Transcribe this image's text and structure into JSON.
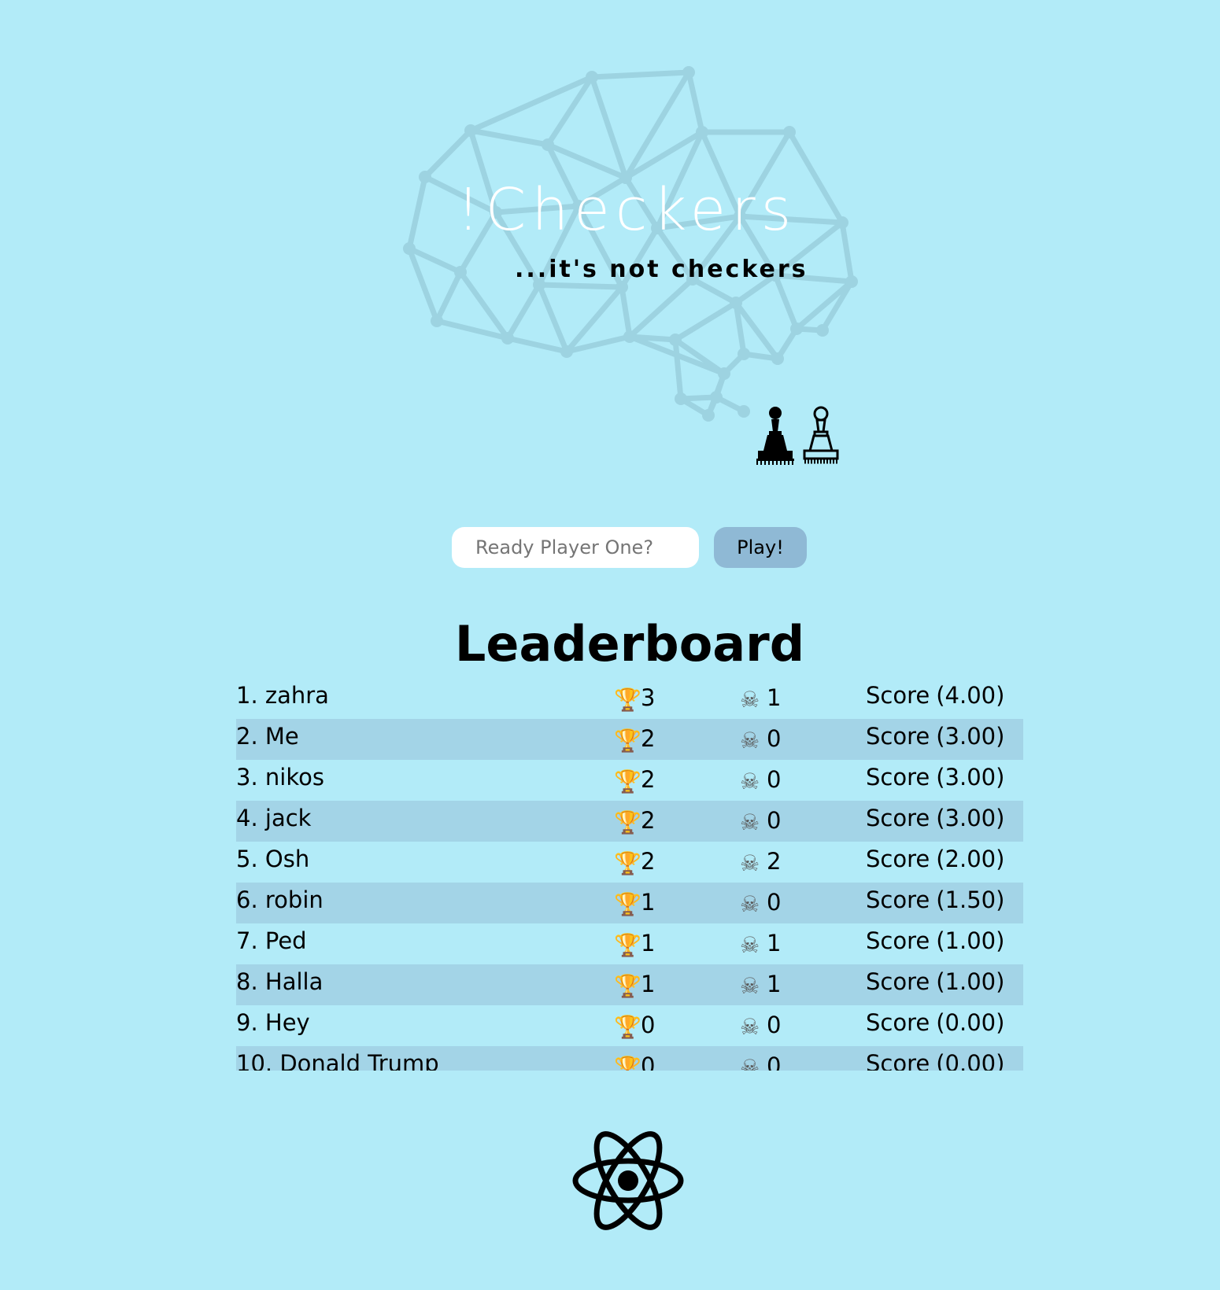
{
  "app": {
    "title": "!Checkers",
    "subtitle": "...it's not checkers"
  },
  "colors": {
    "background": "#b2ebf8",
    "row_alt": "#a3d4e7",
    "play_button": "#8fb9d5",
    "brain": "#9dd3e1"
  },
  "icons": {
    "logo": "brain-network-icon",
    "pieces": [
      "black-pawn-icon",
      "white-pawn-icon"
    ],
    "wins": "trophy-icon",
    "losses": "skull-crossbones-icon",
    "footer": "react-atom-icon"
  },
  "player_form": {
    "input_placeholder": "Ready Player One?",
    "input_value": "",
    "play_label": "Play!"
  },
  "leaderboard": {
    "title": "Leaderboard",
    "score_label": "Score",
    "rows": [
      {
        "rank_name": "1. zahra",
        "wins": "3",
        "losses": "1",
        "score": "(4.00)"
      },
      {
        "rank_name": "2. Me",
        "wins": "2",
        "losses": "0",
        "score": "(3.00)"
      },
      {
        "rank_name": "3. nikos",
        "wins": "2",
        "losses": "0",
        "score": "(3.00)"
      },
      {
        "rank_name": "4. jack",
        "wins": "2",
        "losses": "0",
        "score": "(3.00)"
      },
      {
        "rank_name": "5. Osh",
        "wins": "2",
        "losses": "2",
        "score": "(2.00)"
      },
      {
        "rank_name": "6. robin",
        "wins": "1",
        "losses": "0",
        "score": "(1.50)"
      },
      {
        "rank_name": "7. Ped",
        "wins": "1",
        "losses": "1",
        "score": "(1.00)"
      },
      {
        "rank_name": "8. Halla",
        "wins": "1",
        "losses": "1",
        "score": "(1.00)"
      },
      {
        "rank_name": "9. Hey",
        "wins": "0",
        "losses": "0",
        "score": "(0.00)"
      },
      {
        "rank_name": "10. Donald Trump",
        "wins": "0",
        "losses": "0",
        "score": "(0.00)"
      }
    ]
  }
}
